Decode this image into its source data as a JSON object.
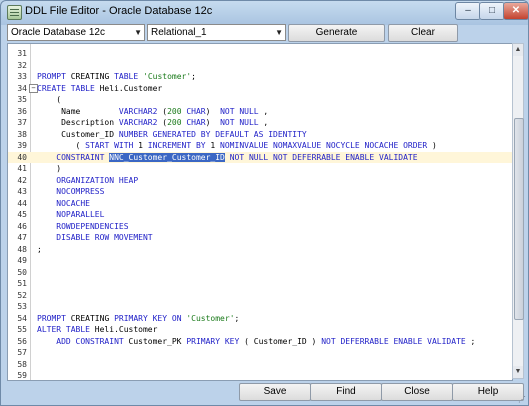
{
  "window": {
    "title": "DDL File Editor - Oracle Database 12c",
    "min_label": "‒",
    "max_label": "□",
    "close_label": "✕"
  },
  "toolbar": {
    "db_select": "Oracle Database 12c",
    "model_select": "Relational_1",
    "generate_label": "Generate",
    "clear_label": "Clear"
  },
  "editor": {
    "lines": [
      {
        "n": "31",
        "html": ""
      },
      {
        "n": "32",
        "html": ""
      },
      {
        "n": "33",
        "html": "<span class=\"kw\">PROMPT</span> CREATING <span class=\"kw\">TABLE</span> <span class=\"str\">'Customer'</span>;"
      },
      {
        "n": "34",
        "html": "<span class=\"kw\">CREATE TABLE</span> Heli.Customer"
      },
      {
        "n": "35",
        "html": "    ("
      },
      {
        "n": "36",
        "html": "     Name        <span class=\"kw\">VARCHAR2</span> (<span class=\"str\">200</span> <span class=\"kw\">CHAR</span>)  <span class=\"kw\">NOT NULL</span> ,"
      },
      {
        "n": "37",
        "html": "     Description <span class=\"kw\">VARCHAR2</span> (<span class=\"str\">200</span> <span class=\"kw\">CHAR</span>)  <span class=\"kw\">NOT NULL</span> ,"
      },
      {
        "n": "38",
        "html": "     Customer_ID <span class=\"kw\">NUMBER GENERATED BY DEFAULT AS IDENTITY</span>"
      },
      {
        "n": "39",
        "html": "        ( <span class=\"kw\">START WITH</span> 1 <span class=\"kw\">INCREMENT BY</span> 1 <span class=\"kw\">NOMINVALUE NOMAXVALUE NOCYCLE NOCACHE ORDER</span> )"
      },
      {
        "n": "40",
        "html": "    <span class=\"kw\">CONSTRAINT</span> <span class=\"sel\">NNC_Customer_Customer_ID</span> <span class=\"kw\">NOT NULL NOT DEFERRABLE ENABLE VALIDATE</span>",
        "current": true
      },
      {
        "n": "41",
        "html": "    )"
      },
      {
        "n": "42",
        "html": "    <span class=\"kw\">ORGANIZATION HEAP</span>"
      },
      {
        "n": "43",
        "html": "    <span class=\"kw\">NOCOMPRESS</span>"
      },
      {
        "n": "44",
        "html": "    <span class=\"kw\">NOCACHE</span>"
      },
      {
        "n": "45",
        "html": "    <span class=\"kw\">NOPARALLEL</span>"
      },
      {
        "n": "46",
        "html": "    <span class=\"kw\">ROWDEPENDENCIES</span>"
      },
      {
        "n": "47",
        "html": "    <span class=\"kw\">DISABLE ROW MOVEMENT</span>"
      },
      {
        "n": "48",
        "html": ";"
      },
      {
        "n": "49",
        "html": ""
      },
      {
        "n": "50",
        "html": ""
      },
      {
        "n": "51",
        "html": ""
      },
      {
        "n": "52",
        "html": ""
      },
      {
        "n": "53",
        "html": ""
      },
      {
        "n": "54",
        "html": "<span class=\"kw\">PROMPT</span> CREATING <span class=\"kw\">PRIMARY KEY ON</span> <span class=\"str\">'Customer'</span>;"
      },
      {
        "n": "55",
        "html": "<span class=\"kw\">ALTER TABLE</span> Heli.Customer"
      },
      {
        "n": "56",
        "html": "    <span class=\"kw\">ADD CONSTRAINT</span> Customer_PK <span class=\"kw\">PRIMARY KEY</span> ( Customer_ID ) <span class=\"kw\">NOT DEFERRABLE ENABLE VALIDATE</span> ;"
      },
      {
        "n": "57",
        "html": ""
      },
      {
        "n": "58",
        "html": ""
      },
      {
        "n": "59",
        "html": ""
      }
    ],
    "fold_line": "34",
    "fold_symbol": "−"
  },
  "buttons": {
    "save": "Save",
    "find": "Find",
    "close": "Close",
    "help": "Help"
  },
  "scroll": {
    "up": "▲",
    "down": "▼"
  }
}
